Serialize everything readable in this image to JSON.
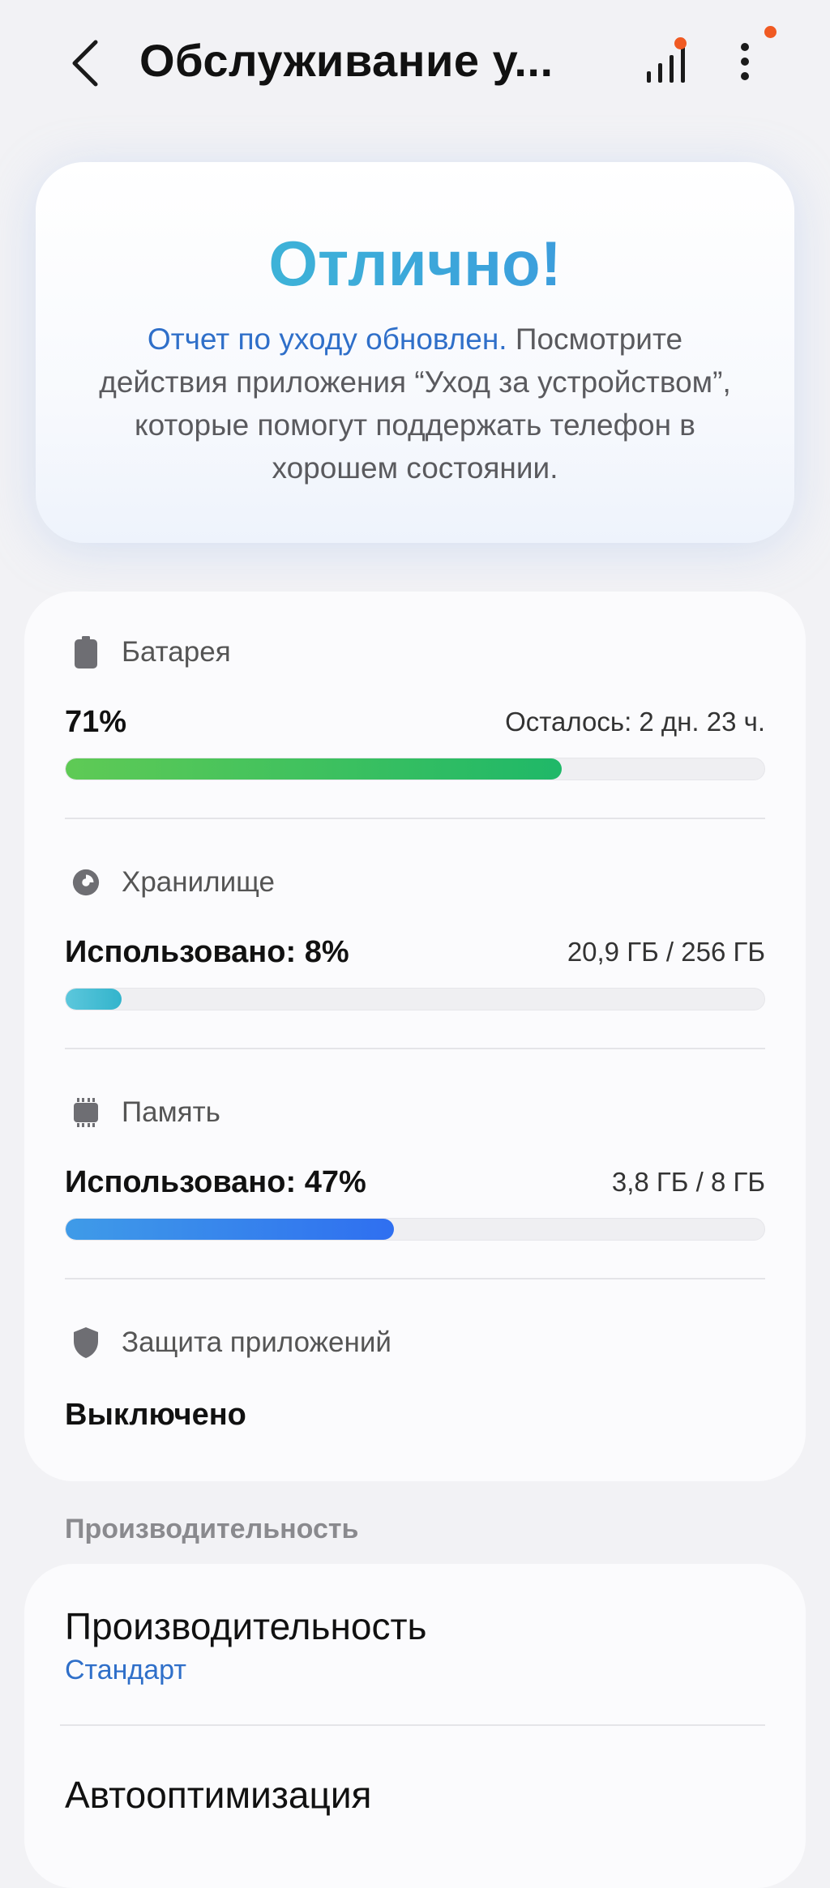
{
  "header": {
    "title": "Обслуживание у...",
    "back_icon": "chevron-left-icon",
    "stats_icon": "bar-chart-icon",
    "more_icon": "more-vertical-icon",
    "badge_color": "#f05a22"
  },
  "hero": {
    "title": "Отлично!",
    "link_text": "Отчет по уходу обновлен.",
    "description": " Посмотрите действия приложения “Уход за устройством”, которые помогут поддержать телефон в хорошем состоянии."
  },
  "battery": {
    "label": "Батарея",
    "icon": "battery-icon",
    "value": "71%",
    "remaining": "Осталось: 2 дн. 23 ч.",
    "level": 0.71,
    "color_start": "#5fca55",
    "color_end": "#1fb868"
  },
  "storage": {
    "label": "Хранилище",
    "icon": "pie-chart-icon",
    "value": "Использовано: 8%",
    "details": "20,9 ГБ / 256 ГБ",
    "level": 0.08,
    "color_start": "#5cc7dc",
    "color_end": "#33b4cc"
  },
  "memory": {
    "label": "Память",
    "icon": "memory-chip-icon",
    "value": "Использовано: 47%",
    "details": "3,8 ГБ / 8 ГБ",
    "level": 0.47,
    "color_start": "#3f9be8",
    "color_end": "#2f6ff0"
  },
  "app_protection": {
    "label": "Защита приложений",
    "icon": "shield-icon",
    "value": "Выключено"
  },
  "performance": {
    "section_header": "Производительность",
    "items": [
      {
        "title": "Производительность",
        "subtitle": "Стандарт"
      },
      {
        "title": "Автооптимизация"
      }
    ]
  }
}
